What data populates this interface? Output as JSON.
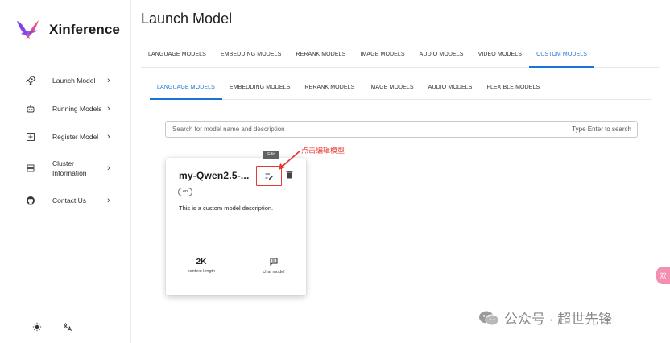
{
  "app": {
    "name": "Xinference"
  },
  "sidebar": {
    "items": [
      {
        "label": "Launch Model",
        "icon": "rocket-icon"
      },
      {
        "label": "Running Models",
        "icon": "robot-icon"
      },
      {
        "label": "Register Model",
        "icon": "plus-box-icon"
      },
      {
        "label_line1": "Cluster",
        "label_line2": "Information",
        "icon": "server-icon"
      },
      {
        "label": "Contact Us",
        "icon": "github-icon"
      }
    ],
    "bottom": {
      "theme_icon": "sun-icon",
      "language_icon": "translate-icon"
    }
  },
  "page": {
    "title": "Launch Model"
  },
  "tabs": [
    {
      "label": "LANGUAGE MODELS",
      "active": false
    },
    {
      "label": "EMBEDDING MODELS",
      "active": false
    },
    {
      "label": "RERANK MODELS",
      "active": false
    },
    {
      "label": "IMAGE MODELS",
      "active": false
    },
    {
      "label": "AUDIO MODELS",
      "active": false
    },
    {
      "label": "VIDEO MODELS",
      "active": false
    },
    {
      "label": "CUSTOM MODELS",
      "active": true
    }
  ],
  "subtabs": [
    {
      "label": "LANGUAGE MODELS",
      "active": true
    },
    {
      "label": "EMBEDDING MODELS",
      "active": false
    },
    {
      "label": "RERANK MODELS",
      "active": false
    },
    {
      "label": "IMAGE MODELS",
      "active": false
    },
    {
      "label": "AUDIO MODELS",
      "active": false
    },
    {
      "label": "FLEXIBLE MODELS",
      "active": false
    }
  ],
  "search": {
    "placeholder": "Search for model name and description",
    "hint": "Type Enter to search"
  },
  "card": {
    "title": "my-Qwen2.5-...",
    "language": "en",
    "description": "This is a custom model description.",
    "context_length_value": "2K",
    "context_length_label": "context length",
    "ability_label": "chat model",
    "edit_tooltip": "Edit"
  },
  "annotation": {
    "text": "点击编辑模型"
  },
  "watermark": {
    "text": "公众号 · 超世先锋"
  },
  "side_tab": {
    "text": "双"
  },
  "colors": {
    "accent": "#1976d2",
    "highlight": "#e53935"
  }
}
